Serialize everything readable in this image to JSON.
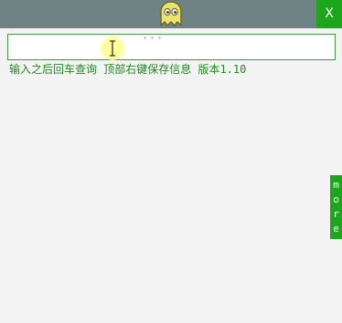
{
  "titlebar": {
    "logo_icon": "yellow-ghost-icon",
    "close_label": "X"
  },
  "search": {
    "value": "",
    "placeholder": ""
  },
  "hint_text": "输入之后回车查询 顶部右键保存信息 版本1.10",
  "more_tab": {
    "letters": [
      "m",
      "o",
      "r",
      "e"
    ]
  },
  "colors": {
    "titlebar": "#6f8284",
    "accent_green": "#1ea51e",
    "hint_green": "#1f8a1f",
    "background": "#f3f3f3"
  }
}
